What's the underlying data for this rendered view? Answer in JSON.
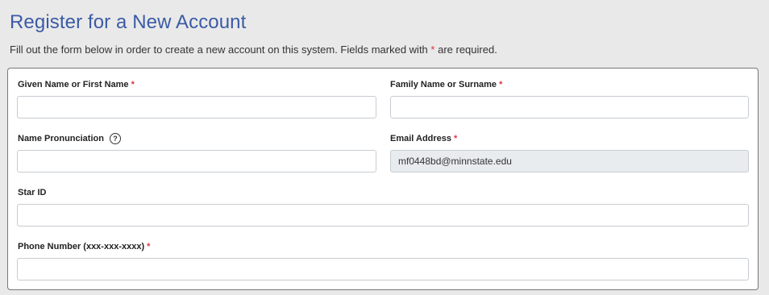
{
  "header": {
    "title": "Register for a New Account",
    "intro_before": "Fill out the form below in order to create a new account on this system. Fields marked with",
    "intro_star": "*",
    "intro_after": "are required."
  },
  "form": {
    "given_name": {
      "label": "Given Name or First Name",
      "required": "*",
      "value": ""
    },
    "family_name": {
      "label": "Family Name or Surname",
      "required": "*",
      "value": ""
    },
    "pronunciation": {
      "label": "Name Pronunciation",
      "help_icon": "question-circle-icon",
      "help_glyph": "?",
      "value": ""
    },
    "email": {
      "label": "Email Address",
      "required": "*",
      "value": "mf0448bd@minnstate.edu"
    },
    "star_id": {
      "label": "Star ID",
      "value": ""
    },
    "phone": {
      "label": "Phone Number (xxx-xxx-xxxx)",
      "required": "*",
      "value": ""
    }
  },
  "colors": {
    "title": "#3b5ba5",
    "required": "#dc3545",
    "readonly_bg": "#e9ecef"
  }
}
